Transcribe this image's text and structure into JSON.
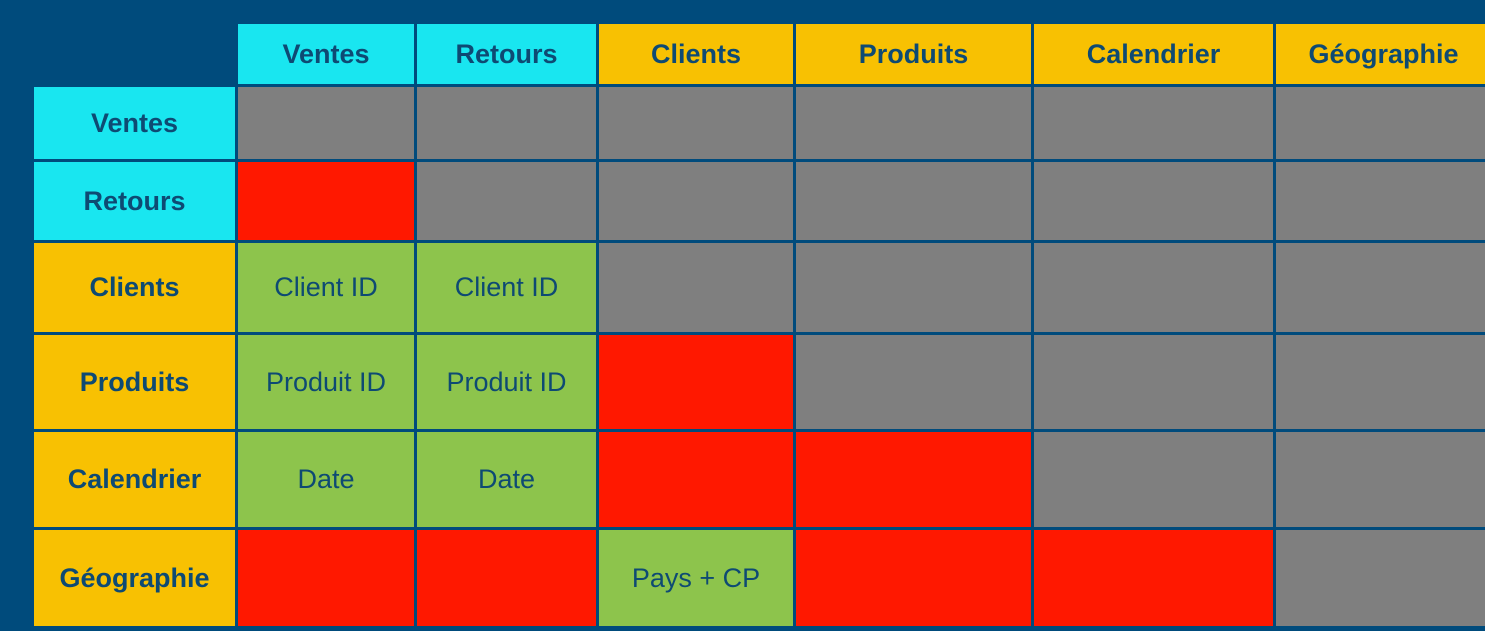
{
  "colors": {
    "background": "#004b7c",
    "fact_table": "#19e6f0",
    "dimension_table": "#f8c102",
    "not_applicable": "#7f7f7f",
    "no_relation": "#ff1800",
    "relation": "#8dc44c",
    "text": "#0e4a73"
  },
  "columns": [
    {
      "label": "Ventes",
      "kind": "fact"
    },
    {
      "label": "Retours",
      "kind": "fact"
    },
    {
      "label": "Clients",
      "kind": "dim"
    },
    {
      "label": "Produits",
      "kind": "dim"
    },
    {
      "label": "Calendrier",
      "kind": "dim"
    },
    {
      "label": "Géographie",
      "kind": "dim"
    }
  ],
  "rows": [
    {
      "label": "Ventes",
      "kind": "fact",
      "cells": [
        {
          "status": "na",
          "text": ""
        },
        {
          "status": "na",
          "text": ""
        },
        {
          "status": "na",
          "text": ""
        },
        {
          "status": "na",
          "text": ""
        },
        {
          "status": "na",
          "text": ""
        },
        {
          "status": "na",
          "text": ""
        }
      ]
    },
    {
      "label": "Retours",
      "kind": "fact",
      "cells": [
        {
          "status": "no",
          "text": ""
        },
        {
          "status": "na",
          "text": ""
        },
        {
          "status": "na",
          "text": ""
        },
        {
          "status": "na",
          "text": ""
        },
        {
          "status": "na",
          "text": ""
        },
        {
          "status": "na",
          "text": ""
        }
      ]
    },
    {
      "label": "Clients",
      "kind": "dim",
      "cells": [
        {
          "status": "yes",
          "text": "Client ID"
        },
        {
          "status": "yes",
          "text": "Client ID"
        },
        {
          "status": "na",
          "text": ""
        },
        {
          "status": "na",
          "text": ""
        },
        {
          "status": "na",
          "text": ""
        },
        {
          "status": "na",
          "text": ""
        }
      ]
    },
    {
      "label": "Produits",
      "kind": "dim",
      "cells": [
        {
          "status": "yes",
          "text": "Produit ID"
        },
        {
          "status": "yes",
          "text": "Produit ID"
        },
        {
          "status": "no",
          "text": ""
        },
        {
          "status": "na",
          "text": ""
        },
        {
          "status": "na",
          "text": ""
        },
        {
          "status": "na",
          "text": ""
        }
      ]
    },
    {
      "label": "Calendrier",
      "kind": "dim",
      "cells": [
        {
          "status": "yes",
          "text": "Date"
        },
        {
          "status": "yes",
          "text": "Date"
        },
        {
          "status": "no",
          "text": ""
        },
        {
          "status": "no",
          "text": ""
        },
        {
          "status": "na",
          "text": ""
        },
        {
          "status": "na",
          "text": ""
        }
      ]
    },
    {
      "label": "Géographie",
      "kind": "dim",
      "cells": [
        {
          "status": "no",
          "text": ""
        },
        {
          "status": "no",
          "text": ""
        },
        {
          "status": "yes",
          "text": "Pays + CP"
        },
        {
          "status": "no",
          "text": ""
        },
        {
          "status": "no",
          "text": ""
        },
        {
          "status": "na",
          "text": ""
        }
      ]
    }
  ]
}
